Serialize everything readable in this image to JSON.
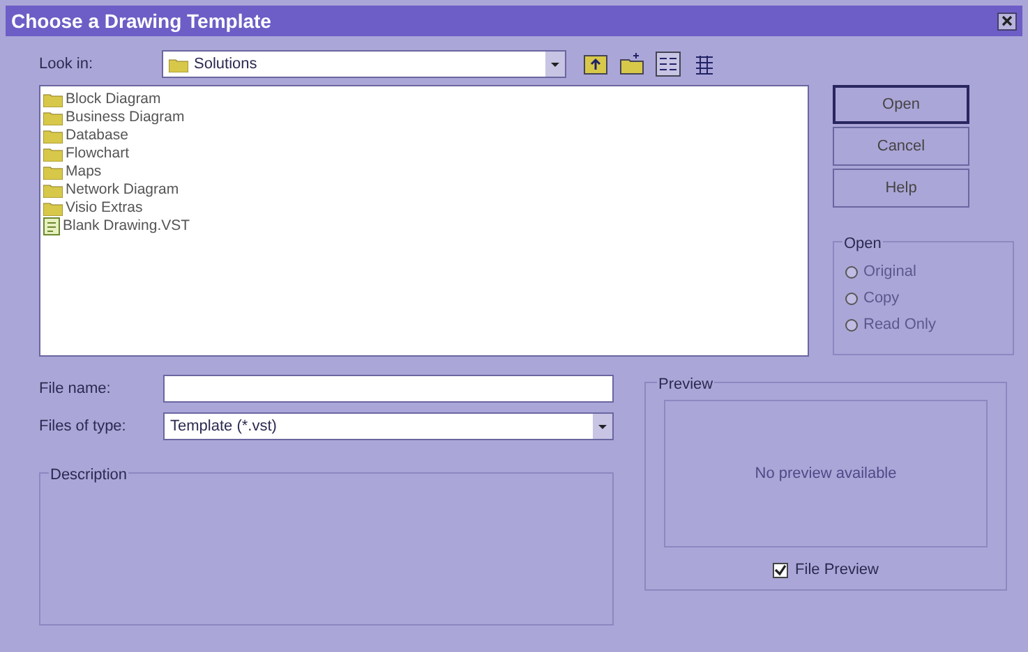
{
  "window": {
    "title": "Choose a Drawing Template"
  },
  "look_in": {
    "label": "Look in:",
    "value": "Solutions"
  },
  "files": [
    {
      "name": "Block Diagram",
      "kind": "folder"
    },
    {
      "name": "Business Diagram",
      "kind": "folder"
    },
    {
      "name": "Database",
      "kind": "folder"
    },
    {
      "name": "Flowchart",
      "kind": "folder"
    },
    {
      "name": "Maps",
      "kind": "folder"
    },
    {
      "name": "Network Diagram",
      "kind": "folder"
    },
    {
      "name": "Visio Extras",
      "kind": "folder"
    },
    {
      "name": "Blank Drawing.VST",
      "kind": "file"
    }
  ],
  "buttons": [
    {
      "label": "Open",
      "default": true
    },
    {
      "label": "Cancel",
      "default": false
    },
    {
      "label": "Help",
      "default": false
    }
  ],
  "open_group": {
    "title": "Open",
    "options": [
      {
        "label": "Original",
        "selected": false,
        "disabled": true
      },
      {
        "label": "Copy",
        "selected": false,
        "disabled": true
      },
      {
        "label": "Read Only",
        "selected": false,
        "disabled": true
      }
    ]
  },
  "file_name": {
    "label": "File name:"
  },
  "file_type": {
    "label": "Files of type:",
    "value": "Template (*.vst)"
  },
  "description": {
    "title": "Description"
  },
  "preview": {
    "title": "Preview",
    "message": "No preview available",
    "checkbox": {
      "label": "File Preview",
      "checked": true
    }
  }
}
